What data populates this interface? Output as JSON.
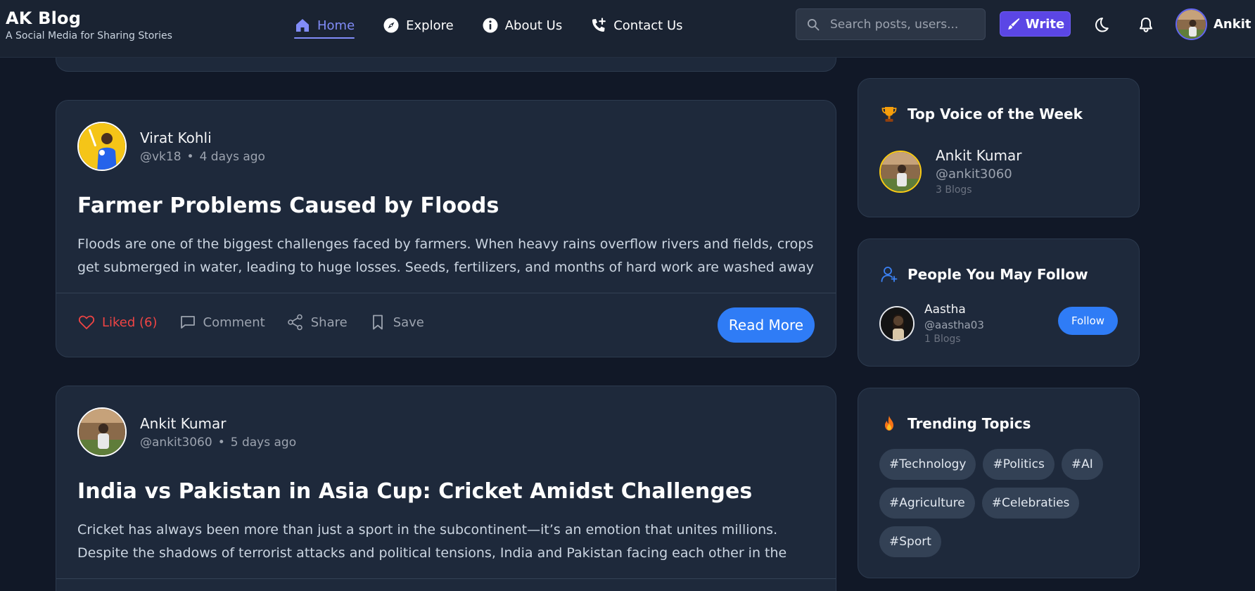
{
  "brand": {
    "title": "AK Blog",
    "subtitle": "A Social Media for Sharing Stories"
  },
  "nav": {
    "items": [
      {
        "label": "Home",
        "icon": "home-icon",
        "active": true
      },
      {
        "label": "Explore",
        "icon": "compass-icon"
      },
      {
        "label": "About Us",
        "icon": "info-icon"
      },
      {
        "label": "Contact Us",
        "icon": "phone-plus-icon"
      }
    ]
  },
  "search": {
    "placeholder": "Search posts, users..."
  },
  "header": {
    "write_label": "Write",
    "user_name": "Ankit"
  },
  "colors": {
    "background": "#111827",
    "card": "#1e293b",
    "accent": "#818cf8",
    "primary_button": "#2f7cf6",
    "write_button": "#5b46e5",
    "liked": "#ef4444"
  },
  "posts": [
    {
      "author": "Virat Kohli",
      "handle": "@vk18",
      "time": "4 days ago",
      "title": "Farmer Problems Caused by Floods",
      "excerpt": "Floods are one of the biggest challenges faced by farmers. When heavy rains overflow rivers and fields, crops get submerged in water, leading to huge losses. Seeds, fertilizers, and months of hard work are washed away within hour...",
      "like_label": "Liked (6)",
      "comment_label": "Comment",
      "share_label": "Share",
      "save_label": "Save",
      "read_more": "Read More"
    },
    {
      "author": "Ankit Kumar",
      "handle": "@ankit3060",
      "time": "5 days ago",
      "title": "India vs Pakistan in Asia Cup: Cricket Amidst Challenges",
      "excerpt": "Cricket has always been more than just a sport in the subcontinent—it’s an emotion that unites millions. Despite the shadows of terrorist attacks and political tensions, India and Pakistan facing each other in the Asia Cup sends a stron..."
    }
  ],
  "top_voice": {
    "title": "Top Voice of the Week",
    "name": "Ankit Kumar",
    "handle": "@ankit3060",
    "blogs": "3 Blogs"
  },
  "people": {
    "title": "People You May Follow",
    "name": "Aastha",
    "handle": "@aastha03",
    "blogs": "1 Blogs",
    "follow_label": "Follow"
  },
  "trending": {
    "title": "Trending Topics",
    "tags": [
      "#Technology",
      "#Politics",
      "#AI",
      "#Agriculture",
      "#Celebraties",
      "#Sport"
    ]
  }
}
